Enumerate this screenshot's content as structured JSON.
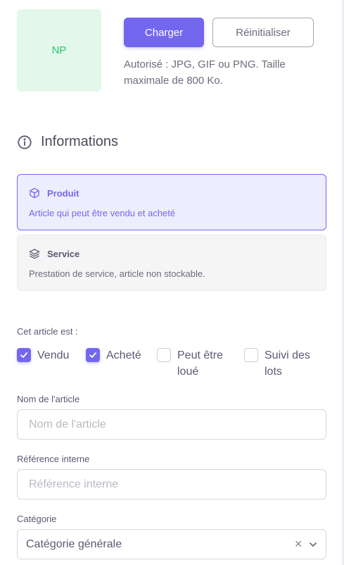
{
  "avatar": {
    "initials": "NP"
  },
  "upload": {
    "upload_label": "Charger",
    "reset_label": "Réinitialiser",
    "hint": "Autorisé : JPG, GIF ou PNG. Taille maximale de 800 Ko."
  },
  "section": {
    "title": "Informations",
    "icon": "info-circle-icon"
  },
  "types": [
    {
      "title": "Produit",
      "description": "Article qui peut être vendu et acheté",
      "icon": "box-icon",
      "selected": true
    },
    {
      "title": "Service",
      "description": "Prestation de service, article non stockable.",
      "icon": "layers-icon",
      "selected": false
    }
  ],
  "flags": {
    "label": "Cet article est :",
    "options": [
      {
        "label": "Vendu",
        "checked": true
      },
      {
        "label": "Acheté",
        "checked": true
      },
      {
        "label": "Peut être loué",
        "checked": false
      },
      {
        "label": "Suivi des lots",
        "checked": false
      }
    ]
  },
  "fields": {
    "name": {
      "label": "Nom de l'article",
      "placeholder": "Nom de l'article",
      "value": ""
    },
    "ref": {
      "label": "Référence interne",
      "placeholder": "Référence interne",
      "value": ""
    },
    "category": {
      "label": "Catégorie",
      "value": "Catégorie générale"
    }
  },
  "colors": {
    "accent": "#7367f0",
    "avatar_bg": "#e3f7ea",
    "avatar_text": "#28c76f"
  }
}
